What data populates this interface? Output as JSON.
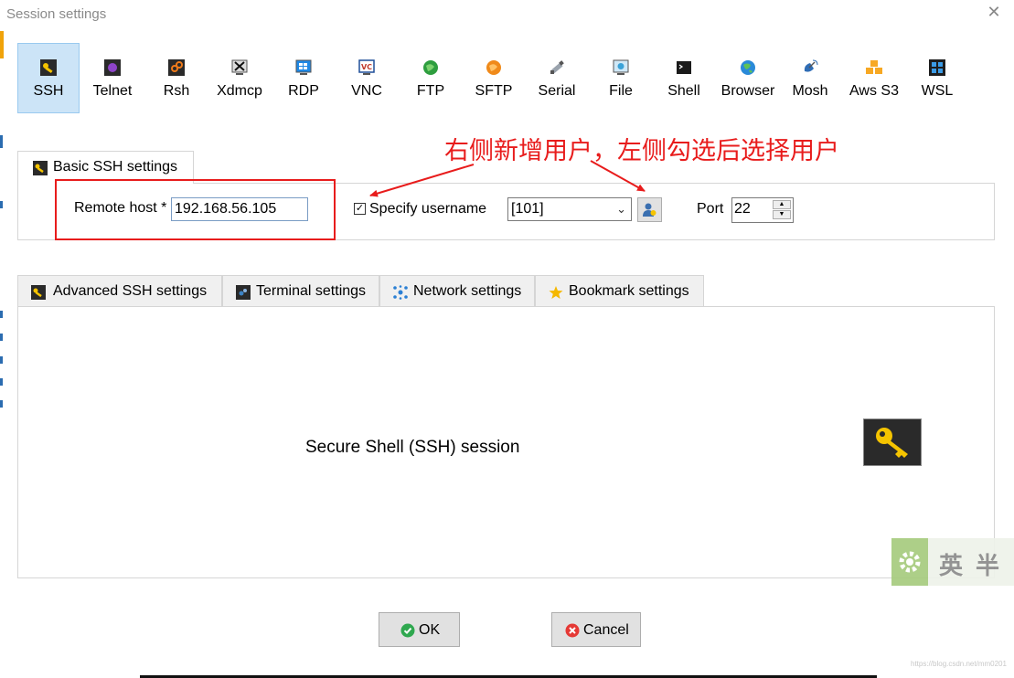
{
  "window": {
    "title": "Session settings",
    "close_icon": "close-icon"
  },
  "protocols": [
    {
      "label": "SSH",
      "icon": "ssh-key-icon",
      "selected": true
    },
    {
      "label": "Telnet",
      "icon": "telnet-icon"
    },
    {
      "label": "Rsh",
      "icon": "rsh-icon"
    },
    {
      "label": "Xdmcp",
      "icon": "xdmcp-icon"
    },
    {
      "label": "RDP",
      "icon": "rdp-icon"
    },
    {
      "label": "VNC",
      "icon": "vnc-icon"
    },
    {
      "label": "FTP",
      "icon": "ftp-globe-icon"
    },
    {
      "label": "SFTP",
      "icon": "sftp-globe-icon"
    },
    {
      "label": "Serial",
      "icon": "serial-icon"
    },
    {
      "label": "File",
      "icon": "file-icon"
    },
    {
      "label": "Shell",
      "icon": "shell-icon"
    },
    {
      "label": "Browser",
      "icon": "browser-globe-icon"
    },
    {
      "label": "Mosh",
      "icon": "mosh-satellite-icon"
    },
    {
      "label": "Aws S3",
      "icon": "aws-s3-icon"
    },
    {
      "label": "WSL",
      "icon": "wsl-windows-icon"
    }
  ],
  "basic": {
    "tab_label": "Basic SSH settings",
    "remote_host_label": "Remote host *",
    "remote_host_value": "192.168.56.105",
    "specify_username_label": "Specify username",
    "specify_username_checked": true,
    "username_value": "[101]",
    "port_label": "Port",
    "port_value": "22"
  },
  "annotation": {
    "text": "右侧新增用户，左侧勾选后选择用户",
    "color": "#e81c1c"
  },
  "lower_tabs": [
    {
      "label": "Advanced SSH settings",
      "icon": "wrench-key-icon"
    },
    {
      "label": "Terminal settings",
      "icon": "terminal-icon"
    },
    {
      "label": "Network settings",
      "icon": "network-icon"
    },
    {
      "label": "Bookmark settings",
      "icon": "star-icon"
    }
  ],
  "description": "Secure Shell (SSH) session",
  "buttons": {
    "ok": "OK",
    "cancel": "Cancel"
  },
  "watermark": {
    "text": "英半"
  },
  "csdn": "https://blog.csdn.net/mm0201"
}
